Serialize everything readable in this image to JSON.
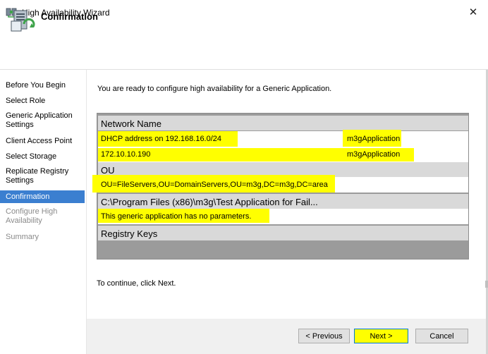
{
  "window": {
    "title": "High Availability Wizard",
    "close_glyph": "✕"
  },
  "header": {
    "title": "Confirmation"
  },
  "nav": {
    "items": [
      {
        "label": "Before You Begin",
        "state": "normal"
      },
      {
        "label": "Select Role",
        "state": "normal"
      },
      {
        "label": "Generic Application Settings",
        "state": "normal"
      },
      {
        "label": "Client Access Point",
        "state": "normal"
      },
      {
        "label": "Select Storage",
        "state": "normal"
      },
      {
        "label": "Replicate Registry Settings",
        "state": "normal"
      },
      {
        "label": "Confirmation",
        "state": "selected"
      },
      {
        "label": "Configure High Availability",
        "state": "disabled"
      },
      {
        "label": "Summary",
        "state": "disabled"
      }
    ]
  },
  "main": {
    "intro": "You are ready to configure high availability for a Generic Application.",
    "table": {
      "network_header": "Network Name",
      "network_rows": [
        {
          "c1": "DHCP address on 192.168.16.0/24",
          "c2": "m3gApplication"
        },
        {
          "c1": "172.10.10.190",
          "c2": "m3gApplication"
        }
      ],
      "ou_header": "OU",
      "ou_value": "OU=FileServers,OU=DomainServers,OU=m3g,DC=m3g,DC=area",
      "path_header": "C:\\Program Files (x86)\\m3g\\Test Application for Fail...",
      "path_value": "This generic application has no parameters.",
      "registry_header": "Registry Keys"
    },
    "continue_text": "To continue, click Next."
  },
  "footer": {
    "previous": "< Previous",
    "next": "Next >",
    "cancel": "Cancel"
  },
  "colors": {
    "highlight": "#ffff00",
    "selection": "#3b7fd0",
    "section_header": "#d9d9d9",
    "table_bg": "#9b9b9b"
  }
}
